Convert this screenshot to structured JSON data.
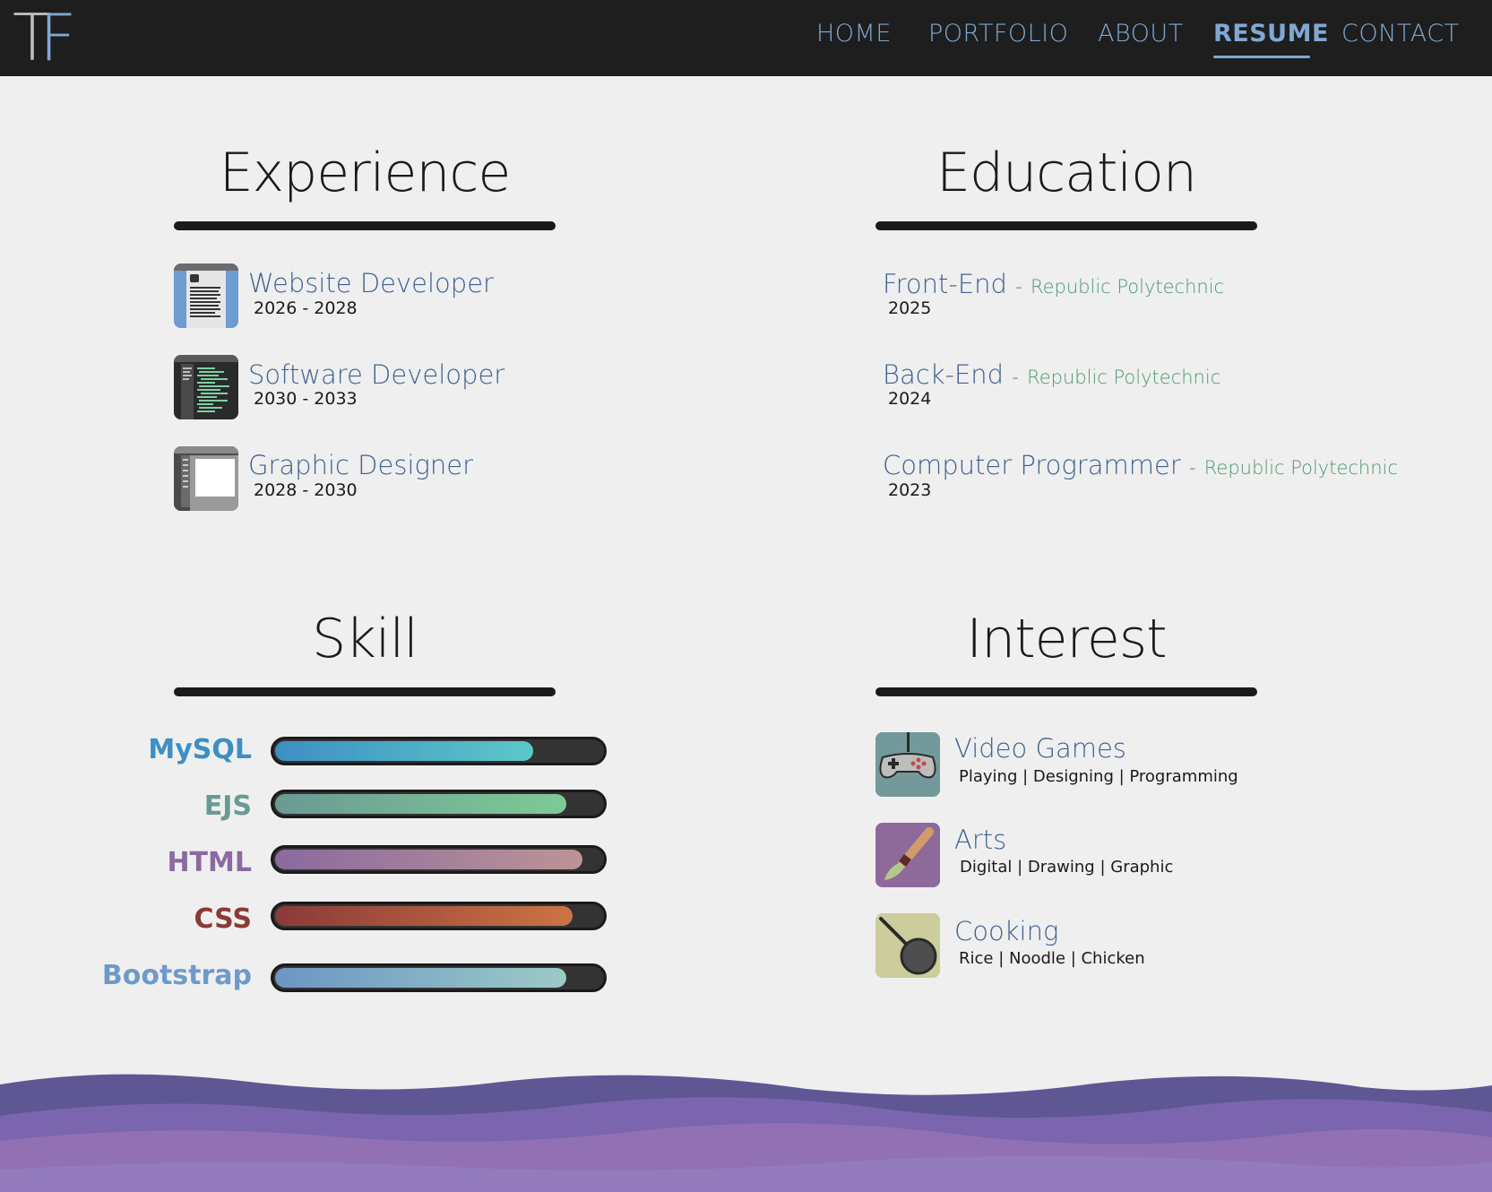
{
  "nav": {
    "logo_t": "T",
    "logo_f": "F",
    "home": "HOME",
    "portfolio": "PORTFOLIO",
    "about": "ABOUT",
    "resume": "RESUME",
    "contact": "CONTACT",
    "active": "RESUME"
  },
  "experience": {
    "title": "Experience",
    "items": [
      {
        "title": "Website Developer",
        "years": "2026 - 2028",
        "icon": "document-icon"
      },
      {
        "title": "Software Developer",
        "years": "2030 - 2033",
        "icon": "code-editor-icon"
      },
      {
        "title": "Graphic Designer",
        "years": "2028 - 2030",
        "icon": "design-canvas-icon"
      }
    ]
  },
  "education": {
    "title": "Education",
    "items": [
      {
        "title": "Front-End",
        "sep": "-",
        "institution": "Republic Polytechnic",
        "year": "2025"
      },
      {
        "title": "Back-End",
        "sep": "-",
        "institution": "Republic Polytechnic",
        "year": "2024"
      },
      {
        "title": "Computer Programmer",
        "sep": "-",
        "institution": "Republic Polytechnic",
        "year": "2023"
      }
    ]
  },
  "skill": {
    "title": "Skill",
    "items": [
      {
        "name": "MySQL",
        "level": 0.79,
        "color": "#3d8fc4",
        "grad": [
          "#3d8fc4",
          "#5cc8c8"
        ]
      },
      {
        "name": "EJS",
        "level": 0.89,
        "color": "#6a9a94",
        "grad": [
          "#6a9a94",
          "#7ecb96"
        ]
      },
      {
        "name": "HTML",
        "level": 0.94,
        "color": "#8a6aa0",
        "grad": [
          "#8a6aa0",
          "#bc9496"
        ]
      },
      {
        "name": "CSS",
        "level": 0.91,
        "color": "#8a3a38",
        "grad": [
          "#8a3a38",
          "#cc7444"
        ]
      },
      {
        "name": "Bootstrap",
        "level": 0.89,
        "color": "#6e9ac8",
        "grad": [
          "#6e94c4",
          "#9ccac6"
        ]
      }
    ]
  },
  "interest": {
    "title": "Interest",
    "items": [
      {
        "title": "Video Games",
        "detail": "Playing | Designing | Programming",
        "icon": "gamepad-icon"
      },
      {
        "title": "Arts",
        "detail": "Digital | Drawing | Graphic",
        "icon": "paintbrush-icon"
      },
      {
        "title": "Cooking",
        "detail": "Rice | Noodle | Chicken",
        "icon": "frying-pan-icon"
      }
    ]
  },
  "colors": {
    "nav_bg": "#1e1e1e",
    "accent": "#7fa8d3",
    "page_bg": "#efefef",
    "heading": "#1a1a1a",
    "item_title": "#3f6191",
    "institution": "#4a9a6e",
    "wave_dark": "#5e5794",
    "wave_mid": "#7a65ae",
    "wave_light": "#9270b4"
  }
}
